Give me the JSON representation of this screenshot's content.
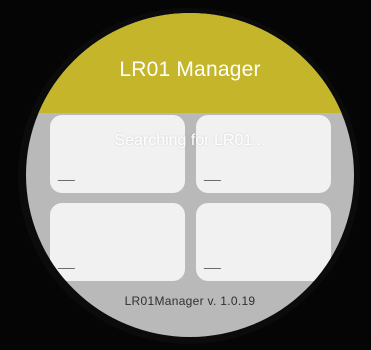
{
  "app": {
    "title": "LR01 Manager",
    "status_text": "Searching for LR01...",
    "version_label": "LR01Manager v. 1.0.19"
  },
  "tiles": [
    {
      "value": "__"
    },
    {
      "value": "__"
    },
    {
      "value": "__"
    },
    {
      "value": "__"
    }
  ],
  "colors": {
    "header": "#c5b52a",
    "face": "#b9b9b9",
    "tile": "#f1f1f1",
    "bezel": "#0b0b0b"
  }
}
